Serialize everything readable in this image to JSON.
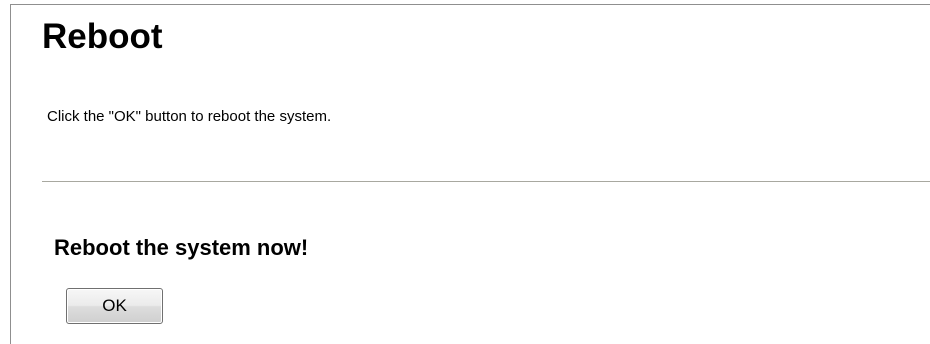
{
  "page": {
    "title": "Reboot",
    "instruction": "Click the \"OK\" button to reboot the system."
  },
  "reboot_section": {
    "title": "Reboot the system now!",
    "ok_label": "OK"
  }
}
